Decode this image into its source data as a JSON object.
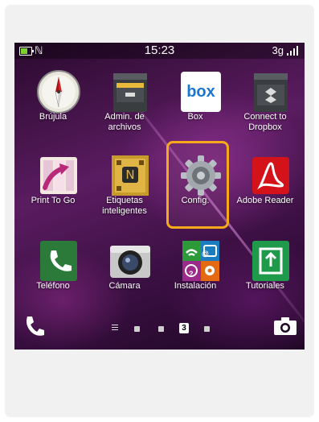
{
  "status": {
    "time": "15:23",
    "network": "3g"
  },
  "apps": [
    {
      "id": "brujula",
      "label": "Brújula"
    },
    {
      "id": "admin",
      "label": "Admin. de archivos"
    },
    {
      "id": "box",
      "label": "Box",
      "brand_text": "box"
    },
    {
      "id": "dropbox",
      "label": "Connect to Dropbox"
    },
    {
      "id": "print",
      "label": "Print To Go"
    },
    {
      "id": "etiquetas",
      "label": "Etiquetas inteligentes"
    },
    {
      "id": "config",
      "label": "Config."
    },
    {
      "id": "adobe",
      "label": "Adobe Reader"
    },
    {
      "id": "telefono",
      "label": "Teléfono"
    },
    {
      "id": "camara",
      "label": "Cámara"
    },
    {
      "id": "instalacion",
      "label": "Instalación"
    },
    {
      "id": "tutoriales",
      "label": "Tutoriales"
    }
  ],
  "dock": {
    "current_page": "3"
  },
  "colors": {
    "highlight": "#f7a81b",
    "adobe_red": "#d3121a",
    "box_blue": "#1a76d2"
  }
}
